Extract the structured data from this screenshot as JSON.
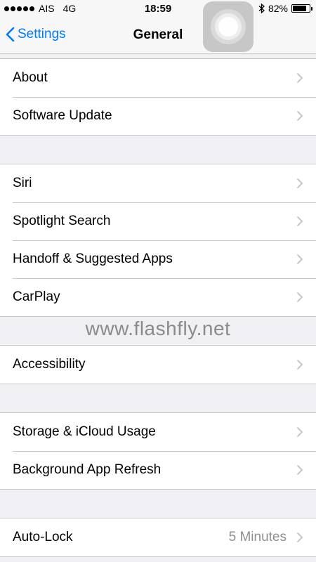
{
  "status_bar": {
    "carrier": "AIS",
    "network": "4G",
    "time": "18:59",
    "battery_percent": "82%",
    "battery_level": 0.82,
    "bluetooth_icon": "bluetooth-icon"
  },
  "nav": {
    "back_label": "Settings",
    "title": "General"
  },
  "groups": {
    "g1": [
      "About",
      "Software Update"
    ],
    "g2": [
      "Siri",
      "Spotlight Search",
      "Handoff & Suggested Apps",
      "CarPlay"
    ],
    "g3": [
      "Accessibility"
    ],
    "g4": [
      "Storage & iCloud Usage",
      "Background App Refresh"
    ],
    "g5": [
      "Auto-Lock"
    ]
  },
  "values": {
    "auto_lock": "5 Minutes"
  },
  "watermark": "www.flashfly.net",
  "colors": {
    "accent": "#007aff",
    "background": "#efeff4",
    "separator": "#c8c7cc",
    "chevron": "#c7c7cc"
  }
}
